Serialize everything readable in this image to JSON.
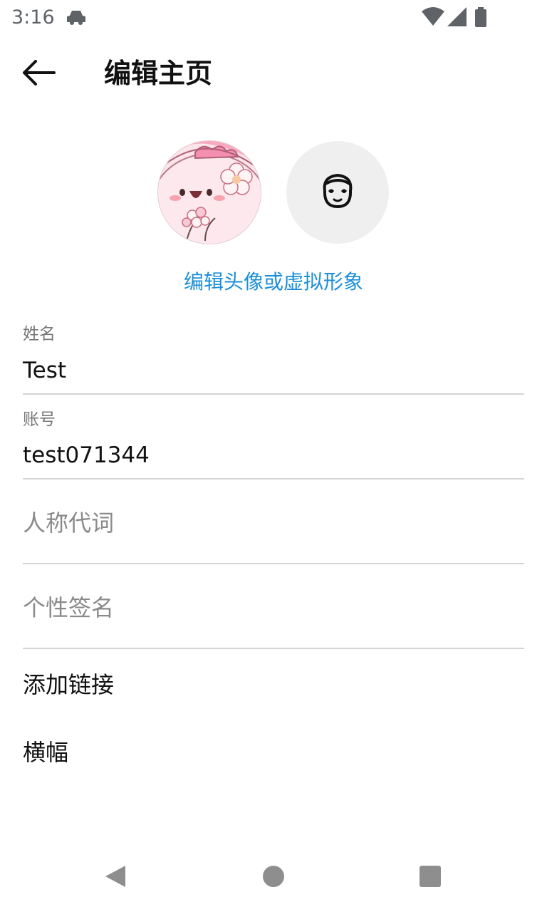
{
  "status_bar": {
    "time": "3:16",
    "app_icon": "car-icon",
    "wifi_icon": "wifi-icon",
    "signal_icon": "signal-icon",
    "battery_icon": "battery-icon"
  },
  "header": {
    "back_icon": "arrow-back-icon",
    "title": "编辑主页"
  },
  "avatars": {
    "profile_image": "cute-pink-character-avatar",
    "avatar_placeholder_icon": "avatar-face-icon",
    "edit_link": "编辑头像或虚拟形象"
  },
  "form": {
    "name": {
      "label": "姓名",
      "value": "Test"
    },
    "account": {
      "label": "账号",
      "value": "test071344"
    },
    "pronouns": {
      "placeholder": "人称代词"
    },
    "bio": {
      "placeholder": "个性签名"
    },
    "add_link": "添加链接",
    "banner": "横幅"
  },
  "nav_bar": {
    "back": "triangle-back-icon",
    "home": "circle-home-icon",
    "recents": "square-recents-icon"
  },
  "colors": {
    "accent_link": "#1c8fd8",
    "divider": "#d4d4d4",
    "placeholder_bg": "#efefef"
  }
}
